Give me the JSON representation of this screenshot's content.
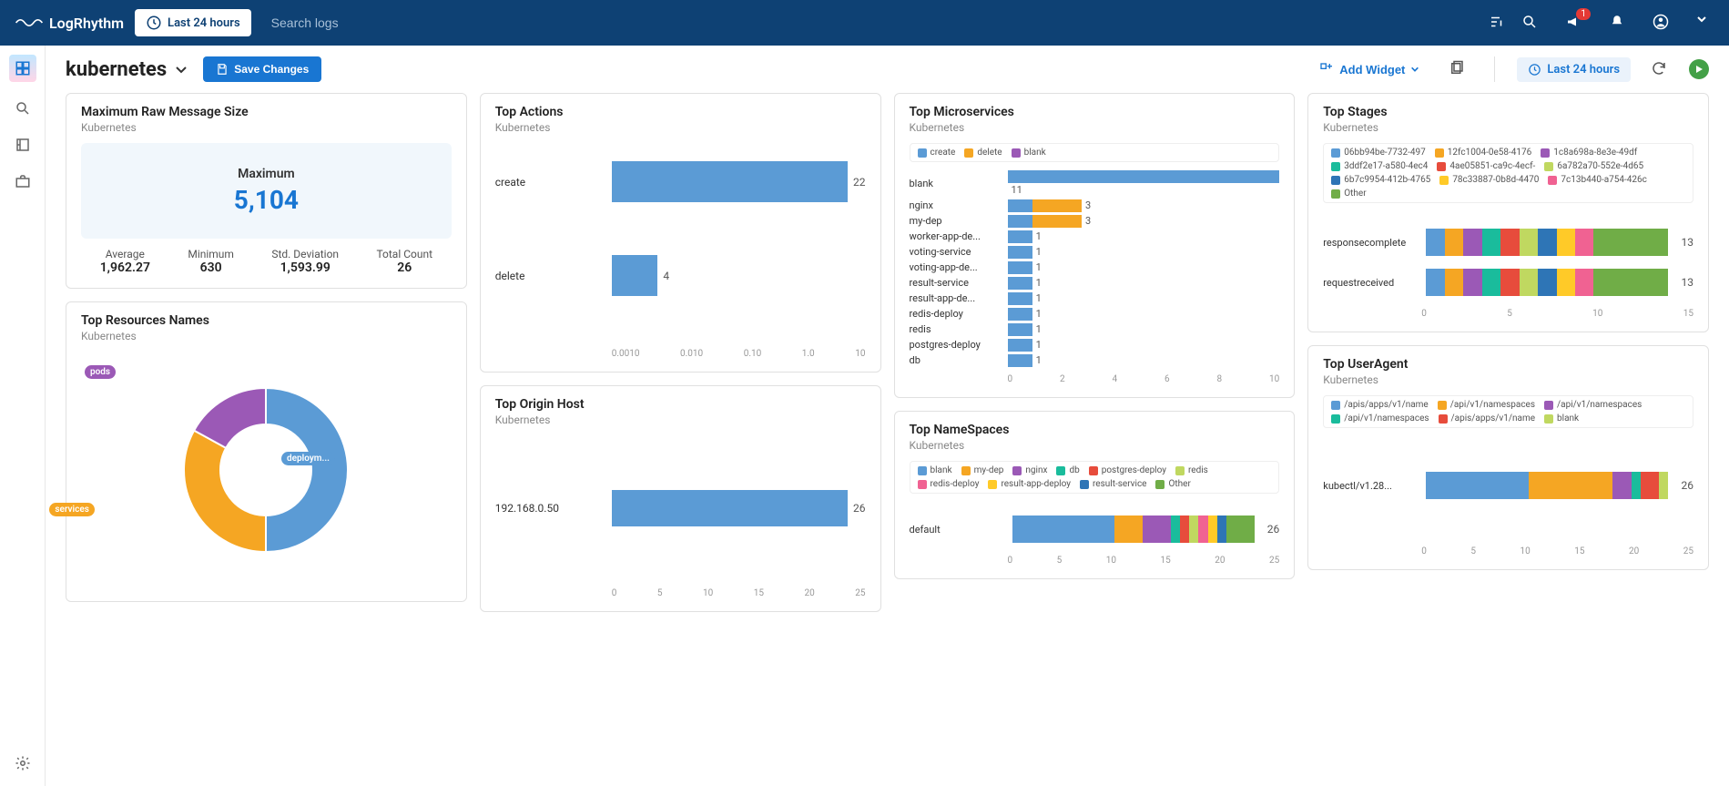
{
  "brand": "LogRhythm",
  "timerange": "Last 24 hours",
  "search_placeholder": "Search logs",
  "notif_badge": "1",
  "dashboard_title": "kubernetes",
  "save_btn": "Save Changes",
  "add_widget": "Add Widget",
  "timerange2": "Last 24 hours",
  "colors": {
    "blue": "#5b9bd5",
    "orange": "#f5a623",
    "green": "#70ad47",
    "red": "#e74c3c",
    "purple": "#9b59b6",
    "teal": "#1abc9c",
    "lime": "#c0d860",
    "pink": "#f06292",
    "darkblue": "#2e75b6",
    "yellow": "#ffca28"
  },
  "cards": {
    "max_msg": {
      "title": "Maximum Raw Message Size",
      "sub": "Kubernetes",
      "metric_label": "Maximum",
      "metric_value": "5,104",
      "stats": [
        {
          "label": "Average",
          "val": "1,962.27"
        },
        {
          "label": "Minimum",
          "val": "630"
        },
        {
          "label": "Std. Deviation",
          "val": "1,593.99"
        },
        {
          "label": "Total Count",
          "val": "26"
        }
      ]
    },
    "resources": {
      "title": "Top Resources Names",
      "sub": "Kubernetes"
    },
    "actions": {
      "title": "Top Actions",
      "sub": "Kubernetes"
    },
    "origin": {
      "title": "Top Origin Host",
      "sub": "Kubernetes"
    },
    "microservices": {
      "title": "Top Microservices",
      "sub": "Kubernetes"
    },
    "namespaces": {
      "title": "Top NameSpaces",
      "sub": "Kubernetes"
    },
    "stages": {
      "title": "Top Stages",
      "sub": "Kubernetes"
    },
    "useragent": {
      "title": "Top UserAgent",
      "sub": "Kubernetes"
    }
  },
  "chart_data": {
    "resources": {
      "type": "pie",
      "slices": [
        {
          "label": "deploym...",
          "value": 50,
          "color": "#5b9bd5"
        },
        {
          "label": "services",
          "value": 33,
          "color": "#f5a623"
        },
        {
          "label": "pods",
          "value": 17,
          "color": "#9b59b6"
        }
      ]
    },
    "actions": {
      "type": "bar",
      "orientation": "h",
      "xscale": "log",
      "xticks": [
        "0.0010",
        "0.010",
        "0.10",
        "1.0",
        "10"
      ],
      "categories": [
        "create",
        "delete"
      ],
      "values": [
        22,
        4
      ]
    },
    "origin": {
      "type": "bar",
      "orientation": "h",
      "xticks": [
        "0",
        "5",
        "10",
        "15",
        "20",
        "25"
      ],
      "categories": [
        "192.168.0.50"
      ],
      "values": [
        26
      ]
    },
    "microservices": {
      "type": "bar_grouped",
      "orientation": "h",
      "legend": [
        {
          "name": "create",
          "color": "#5b9bd5"
        },
        {
          "name": "delete",
          "color": "#f5a623"
        },
        {
          "name": "blank",
          "color": "#9b59b6"
        }
      ],
      "xticks": [
        "0",
        "2",
        "4",
        "6",
        "8",
        "10"
      ],
      "rows": [
        {
          "cat": "blank",
          "bars": [
            {
              "series": "create",
              "val": 11
            }
          ]
        },
        {
          "cat": "nginx",
          "bars": [
            {
              "series": "create",
              "val": 1
            },
            {
              "series": "delete",
              "val": 2
            }
          ],
          "label": "3"
        },
        {
          "cat": "my-dep",
          "bars": [
            {
              "series": "create",
              "val": 1
            },
            {
              "series": "delete",
              "val": 2
            }
          ],
          "label": "3"
        },
        {
          "cat": "worker-app-de...",
          "bars": [
            {
              "series": "create",
              "val": 1
            }
          ]
        },
        {
          "cat": "voting-service",
          "bars": [
            {
              "series": "create",
              "val": 1
            }
          ]
        },
        {
          "cat": "voting-app-de...",
          "bars": [
            {
              "series": "create",
              "val": 1
            }
          ]
        },
        {
          "cat": "result-service",
          "bars": [
            {
              "series": "create",
              "val": 1
            }
          ]
        },
        {
          "cat": "result-app-de...",
          "bars": [
            {
              "series": "create",
              "val": 1
            }
          ]
        },
        {
          "cat": "redis-deploy",
          "bars": [
            {
              "series": "create",
              "val": 1
            }
          ]
        },
        {
          "cat": "redis",
          "bars": [
            {
              "series": "create",
              "val": 1
            }
          ]
        },
        {
          "cat": "postgres-deploy",
          "bars": [
            {
              "series": "create",
              "val": 1
            }
          ]
        },
        {
          "cat": "db",
          "bars": [
            {
              "series": "create",
              "val": 1
            }
          ]
        }
      ]
    },
    "namespaces": {
      "type": "bar_stacked",
      "orientation": "h",
      "legend": [
        {
          "name": "blank",
          "color": "#5b9bd5"
        },
        {
          "name": "my-dep",
          "color": "#f5a623"
        },
        {
          "name": "nginx",
          "color": "#9b59b6"
        },
        {
          "name": "db",
          "color": "#1abc9c"
        },
        {
          "name": "postgres-deploy",
          "color": "#e74c3c"
        },
        {
          "name": "redis",
          "color": "#c0d860"
        },
        {
          "name": "redis-deploy",
          "color": "#f06292"
        },
        {
          "name": "result-app-deploy",
          "color": "#ffca28"
        },
        {
          "name": "result-service",
          "color": "#2e75b6"
        },
        {
          "name": "Other",
          "color": "#70ad47"
        }
      ],
      "xticks": [
        "0",
        "5",
        "10",
        "15",
        "20",
        "25"
      ],
      "rows": [
        {
          "cat": "default",
          "total": 26,
          "segs": [
            {
              "c": "#5b9bd5",
              "v": 11
            },
            {
              "c": "#f5a623",
              "v": 3
            },
            {
              "c": "#9b59b6",
              "v": 3
            },
            {
              "c": "#1abc9c",
              "v": 1
            },
            {
              "c": "#e74c3c",
              "v": 1
            },
            {
              "c": "#c0d860",
              "v": 1
            },
            {
              "c": "#f06292",
              "v": 1
            },
            {
              "c": "#ffca28",
              "v": 1
            },
            {
              "c": "#2e75b6",
              "v": 1
            },
            {
              "c": "#70ad47",
              "v": 3
            }
          ]
        }
      ]
    },
    "stages": {
      "type": "bar_stacked",
      "orientation": "h",
      "legend": [
        {
          "name": "06bb94be-7732-497",
          "color": "#5b9bd5"
        },
        {
          "name": "12fc1004-0e58-4176",
          "color": "#f5a623"
        },
        {
          "name": "1c8a698a-8e3e-49df",
          "color": "#9b59b6"
        },
        {
          "name": "3ddf2e17-a580-4ec4",
          "color": "#1abc9c"
        },
        {
          "name": "4ae05851-ca9c-4ecf-",
          "color": "#e74c3c"
        },
        {
          "name": "6a782a70-552e-4d65",
          "color": "#c0d860"
        },
        {
          "name": "6b7c9954-412b-4765",
          "color": "#2e75b6"
        },
        {
          "name": "78c33887-0b8d-4470",
          "color": "#ffca28"
        },
        {
          "name": "7c13b440-a754-426c",
          "color": "#f06292"
        },
        {
          "name": "Other",
          "color": "#70ad47"
        }
      ],
      "xticks": [
        "0",
        "5",
        "10",
        "15"
      ],
      "rows": [
        {
          "cat": "responsecomplete",
          "total": 13,
          "segs": [
            {
              "c": "#5b9bd5",
              "v": 1
            },
            {
              "c": "#f5a623",
              "v": 1
            },
            {
              "c": "#9b59b6",
              "v": 1
            },
            {
              "c": "#1abc9c",
              "v": 1
            },
            {
              "c": "#e74c3c",
              "v": 1
            },
            {
              "c": "#c0d860",
              "v": 1
            },
            {
              "c": "#2e75b6",
              "v": 1
            },
            {
              "c": "#ffca28",
              "v": 1
            },
            {
              "c": "#f06292",
              "v": 1
            },
            {
              "c": "#70ad47",
              "v": 4
            }
          ]
        },
        {
          "cat": "requestreceived",
          "total": 13,
          "segs": [
            {
              "c": "#5b9bd5",
              "v": 1
            },
            {
              "c": "#f5a623",
              "v": 1
            },
            {
              "c": "#9b59b6",
              "v": 1
            },
            {
              "c": "#1abc9c",
              "v": 1
            },
            {
              "c": "#e74c3c",
              "v": 1
            },
            {
              "c": "#c0d860",
              "v": 1
            },
            {
              "c": "#2e75b6",
              "v": 1
            },
            {
              "c": "#ffca28",
              "v": 1
            },
            {
              "c": "#f06292",
              "v": 1
            },
            {
              "c": "#70ad47",
              "v": 4
            }
          ]
        }
      ]
    },
    "useragent": {
      "type": "bar_stacked",
      "orientation": "h",
      "legend": [
        {
          "name": "/apis/apps/v1/name",
          "color": "#5b9bd5"
        },
        {
          "name": "/api/v1/namespaces",
          "color": "#f5a623"
        },
        {
          "name": "/api/v1/namespaces",
          "color": "#9b59b6"
        },
        {
          "name": "/api/v1/namespaces",
          "color": "#1abc9c"
        },
        {
          "name": "/apis/apps/v1/name",
          "color": "#e74c3c"
        },
        {
          "name": "blank",
          "color": "#c0d860"
        }
      ],
      "xticks": [
        "0",
        "5",
        "10",
        "15",
        "20",
        "25"
      ],
      "rows": [
        {
          "cat": "kubectl/v1.28...",
          "total": 26,
          "segs": [
            {
              "c": "#5b9bd5",
              "v": 11
            },
            {
              "c": "#f5a623",
              "v": 9
            },
            {
              "c": "#9b59b6",
              "v": 2
            },
            {
              "c": "#1abc9c",
              "v": 1
            },
            {
              "c": "#e74c3c",
              "v": 2
            },
            {
              "c": "#c0d860",
              "v": 1
            }
          ]
        }
      ]
    }
  }
}
